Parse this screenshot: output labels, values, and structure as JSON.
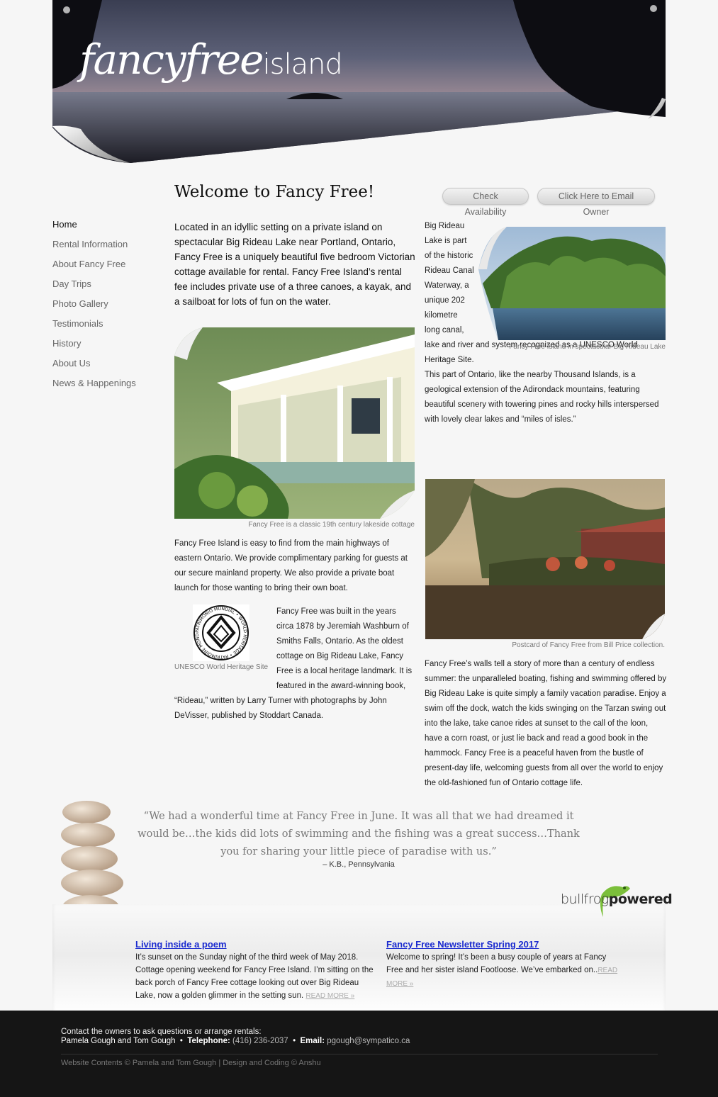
{
  "brand": {
    "logo_script": "fancyfree",
    "logo_sans": "island"
  },
  "nav": {
    "items": [
      {
        "label": "Home"
      },
      {
        "label": "Rental Information"
      },
      {
        "label": "About Fancy Free"
      },
      {
        "label": "Day Trips"
      },
      {
        "label": "Photo Gallery"
      },
      {
        "label": "Testimonials"
      },
      {
        "label": "History"
      },
      {
        "label": "About Us"
      },
      {
        "label": "News & Happenings"
      }
    ]
  },
  "main": {
    "title": "Welcome to Fancy Free!",
    "check_availability": "Check Availability",
    "email_owner": "Click Here to Email Owner",
    "intro": "Located in an idyllic setting on a private island on spectacular Big Rideau Lake near Portland, Ontario, Fancy Free is a uniquely beautiful five bedroom Victorian cottage available for rental. Fancy Free Island’s rental fee includes private use of a three canoes, a kayak, and a sailboat for lots of fun on the water.",
    "rideau_narrow": "Big Rideau Lake is part of the historic Rideau Canal Waterway, a unique 202 kilometre long canal,",
    "rideau_wide": "lake and river and system recognized as a UNESCO World Heritage Site.",
    "ontario_text": "This part of Ontario, like the nearby Thousand Islands, is a geological extension of the Adirondack mountains, featuring beautiful scenery with towering pines and rocky hills interspersed with lovely clear lakes and “miles of isles.”",
    "caption_island": "Fancy Free Island in spectacular Big Rideau Lake",
    "caption_cottage": "Fancy Free is a classic 19th century lakeside cottage",
    "caption_postcard": "Postcard of Fancy Free from Bill Price collection.",
    "caption_unesco": "UNESCO World Heritage Site",
    "find_text": "Fancy Free Island is easy to find from the main highways of eastern Ontario. We provide complimentary parking for guests at our secure mainland property. We also provide a private boat launch for those wanting to bring their own boat.",
    "built_text": "Fancy Free was built in the years circa 1878 by Jeremiah Washburn of Smiths Falls, Ontario. As the oldest cottage on Big Rideau Lake, Fancy Free is a local heritage landmark. It is featured in the award-winning book,",
    "built_text_2": "“Rideau,” written by Larry Turner with photographs by John DeVisser, published by Stoddart Canada.",
    "walls_text": "Fancy Free’s walls tell a story of more than a century of endless summer: the unparalleled boating, fishing and swimming offered by Big Rideau Lake is quite simply a family vacation paradise. Enjoy a swim off the dock, watch the kids swinging on the Tarzan swing out into the lake, take canoe rides at sunset to the call of the loon, have a corn roast, or just lie back and read a good book in the hammock. Fancy Free is a peaceful haven from the bustle of present-day life, welcoming guests from all over the world to enjoy the old-fashioned fun of Ontario cottage life."
  },
  "testimonial": {
    "quote": "“We had a wonderful time at Fancy Free in June. It was all that we had dreamed it would be…the kids did lots of swimming and the fishing was a great success…Thank you for sharing your little piece of paradise with us.”",
    "author": "– K.B., Pennsylvania"
  },
  "bullfrog": {
    "text_a": "bullfrog",
    "text_b": "powered"
  },
  "news": [
    {
      "title": "Living inside a poem",
      "text": "It’s sunset on the Sunday night of the third week of May 2018. Cottage opening weekend for Fancy Free Island. I’m sitting on the back porch of Fancy Free cottage looking out over Big Rideau Lake, now a golden glimmer in the setting sun.",
      "more": "READ MORE »"
    },
    {
      "title": "Fancy Free Newsletter Spring 2017",
      "text": "Welcome to spring! It’s been a busy couple of years at Fancy Free and her sister island Footloose. We’ve embarked on..",
      "more": "READ MORE »"
    }
  ],
  "footer": {
    "contact_line": "Contact the owners to ask questions or arrange rentals:",
    "names": "Pamela Gough and Tom Gough",
    "telephone_label": "Telephone:",
    "telephone": "(416) 236-2037",
    "email_label": "Email:",
    "email": "pgough@sympatico.ca",
    "copyright": "Website Contents © Pamela and Tom Gough | Design and Coding © Anshu"
  },
  "unesco_logo": {
    "ring_text": "PATRIMONIO MUNDIAL • WORLD HERITAGE • PATRIMOINE MONDIAL •"
  },
  "colors": {
    "link_blue": "#1b2bcf",
    "footer_bg": "#151515",
    "page_bg": "#f6f6f6"
  }
}
